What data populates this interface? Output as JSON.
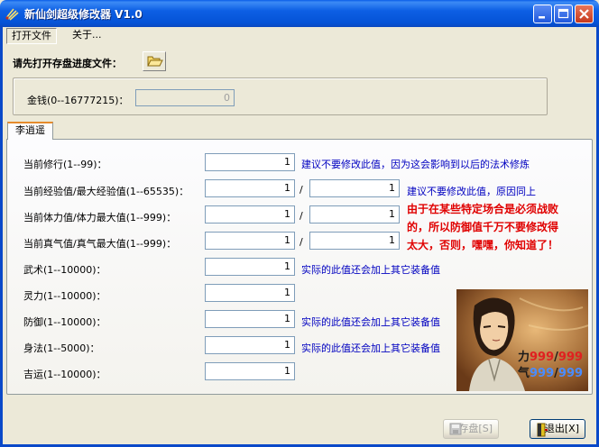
{
  "window": {
    "title": "新仙剑超级修改器 V1.0"
  },
  "menu": {
    "open_file": "打开文件",
    "about": "关于..."
  },
  "open_prompt": "请先打开存盘进度文件：",
  "money": {
    "label": "金钱(0--16777215)：",
    "value": "0"
  },
  "character_tab": "李逍遥",
  "stats": {
    "cultivation": {
      "label": "当前修行(1--99)：",
      "value": "1"
    },
    "experience": {
      "label": "当前经验值/最大经验值(1--65535)：",
      "current": "1",
      "max": "1"
    },
    "hp": {
      "label": "当前体力值/体力最大值(1--999)：",
      "current": "1",
      "max": "1"
    },
    "mp": {
      "label": "当前真气值/真气最大值(1--999)：",
      "current": "1",
      "max": "1"
    },
    "martial": {
      "label": "武术(1--10000)：",
      "value": "1"
    },
    "spirit": {
      "label": "灵力(1--10000)：",
      "value": "1"
    },
    "defense": {
      "label": "防御(1--10000)：",
      "value": "1"
    },
    "agility": {
      "label": "身法(1--5000)：",
      "value": "1"
    },
    "luck": {
      "label": "吉运(1--10000)：",
      "value": "1"
    }
  },
  "separator": "/",
  "notes": {
    "cultivation": "建议不要修改此值，因为这会影响到以后的法术修炼",
    "experience": "建议不要修改此值，原因同上",
    "warning_line1": "由于在某些特定场合是必须战败",
    "warning_line2": "的，所以防御值千万不要修改得",
    "warning_line3": "太大，否则，嘿嘿，你知道了！",
    "martial": "实际的此值还会加上其它装备值",
    "defense": "实际的此值还会加上其它装备值",
    "agility": "实际的此值还会加上其它装备值"
  },
  "portrait": {
    "hp_label": "力",
    "hp_value": "999",
    "hp_max": "999",
    "mp_label": "气",
    "mp_value": "999",
    "mp_max": "999",
    "hp_color": "#e02020",
    "mp_color": "#4a8cff"
  },
  "buttons": {
    "save": "存盘[S]",
    "exit": "退出[X]"
  },
  "colors": {
    "titlebar": "#0a5ee8",
    "note": "#0000c0",
    "warning": "#e00000",
    "tab_highlight": "#e68b2c"
  },
  "icons": {
    "app": "sword-app-icon",
    "folder": "folder-open-icon",
    "save": "disk-icon",
    "exit": "exit-door-icon"
  }
}
